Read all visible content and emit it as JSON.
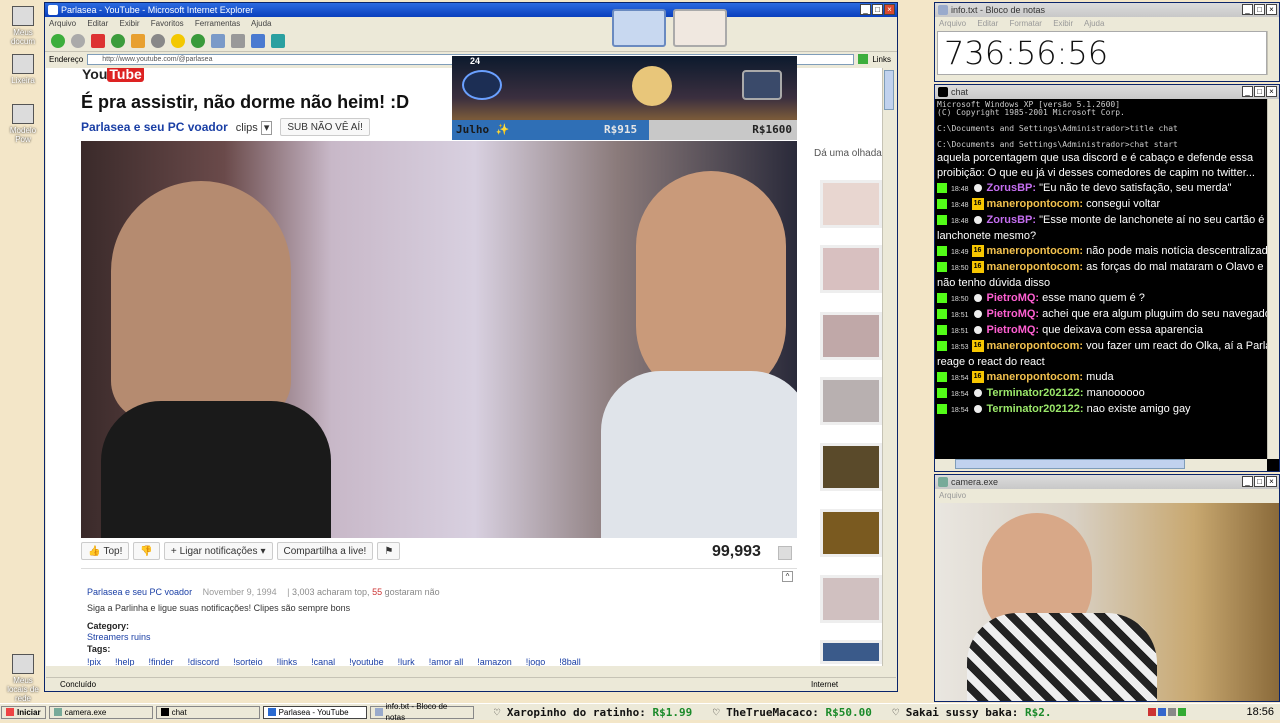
{
  "desktop": {
    "icons": [
      "Meus docum",
      "Lixeira",
      "Modelo Pow",
      "Meus locais de rede"
    ]
  },
  "ie": {
    "title": "Parlasea - YouTube - Microsoft Internet Explorer",
    "menu": [
      "Arquivo",
      "Editar",
      "Exibir",
      "Favoritos",
      "Ferramentas",
      "Ajuda"
    ],
    "address_label": "Endereço",
    "url": "http://www.youtube.com/@parlasea",
    "links_label": "Links",
    "status_left": "Concluído",
    "status_right": "Internet"
  },
  "youtube": {
    "logo": "YouTube",
    "title": "É pra assistir, não dorme não heim! :D",
    "channel": "Parlasea e seu PC voador",
    "clips": "clips",
    "sub_button": "SUB NÃO VÊ AÍ!",
    "like_label": "Top!",
    "notify_label": "Ligar notificações",
    "share_label": "Compartilha a live!",
    "views": "99,993",
    "side_label": "Dá uma olhada",
    "desc_channel": "Parlasea e seu PC voador",
    "desc_date": "November 9, 1994",
    "desc_stats_a": "3,003 acharam top, ",
    "desc_stats_b": "55",
    "desc_stats_c": " gostaram não",
    "desc_text": "Siga a Parlinha e ligue suas notificações! Clipes são sempre bons",
    "category_label": "Category:",
    "category_value": "Streamers ruins",
    "tags_label": "Tags:",
    "tags": [
      "!pix",
      "!help",
      "!finder",
      "!discord",
      "!sorteio",
      "!links",
      "!canal",
      "!youtube",
      "!lurk",
      "!amor all",
      "!amazon",
      "!jogo",
      "!8ball"
    ]
  },
  "game": {
    "month": "Julho ✨",
    "amount_left": "R$915",
    "amount_right": "R$1600",
    "hp": "24"
  },
  "notepad": {
    "title": "info.txt - Bloco de notas",
    "menu": [
      "Arquivo",
      "Editar",
      "Formatar",
      "Exibir",
      "Ajuda"
    ],
    "content": "736:56:56"
  },
  "cmd": {
    "title": "chat",
    "lines": [
      "Microsoft Windows XP [versão 5.1.2600]",
      "(C) Copyright 1985-2001 Microsoft Corp.",
      "C:\\Documents and Settings\\Administrador>title chat",
      "C:\\Documents and Settings\\Administrador>chat start"
    ]
  },
  "chat": {
    "top_text": "aquela porcentagem que usa discord e é cabaço e defende essa proibição: O que eu já vi desses comedores de capim no twitter...",
    "messages": [
      {
        "time": "18:48",
        "badge": "",
        "user": "ZorusBP:",
        "color": "#c46ef0",
        "text": "\"Eu não te devo satisfação, seu merda\""
      },
      {
        "time": "18:48",
        "badge": "16",
        "user": "maneropontocom:",
        "color": "#f2c14e",
        "text": "consegui voltar"
      },
      {
        "time": "18:48",
        "badge": "",
        "user": "ZorusBP:",
        "color": "#c46ef0",
        "text": "\"Esse monte de lanchonete aí no seu cartão é lanchonete mesmo?"
      },
      {
        "time": "18:49",
        "badge": "16",
        "user": "maneropontocom:",
        "color": "#f2c14e",
        "text": "não pode mais notícia descentralizada"
      },
      {
        "time": "18:50",
        "badge": "16",
        "user": "maneropontocom:",
        "color": "#f2c14e",
        "text": "as forças do mal mataram o Olavo e eu não tenho dúvida disso"
      },
      {
        "time": "18:50",
        "badge": "",
        "user": "PietroMQ:",
        "color": "#ff5fd2",
        "text": "esse mano quem é ?"
      },
      {
        "time": "18:51",
        "badge": "",
        "user": "PietroMQ:",
        "color": "#ff5fd2",
        "text": "achei que era algum pluguim do seu navegador"
      },
      {
        "time": "18:51",
        "badge": "",
        "user": "PietroMQ:",
        "color": "#ff5fd2",
        "text": "que deixava com essa aparencia"
      },
      {
        "time": "18:53",
        "badge": "16",
        "user": "maneropontocom:",
        "color": "#f2c14e",
        "text": "vou fazer um react do Olka, aí a Parla reage o react do react"
      },
      {
        "time": "18:54",
        "badge": "16",
        "user": "maneropontocom:",
        "color": "#f2c14e",
        "text": "muda"
      },
      {
        "time": "18:54",
        "badge": "",
        "user": "Terminator202122:",
        "color": "#9be86a",
        "text": "manoooooo"
      },
      {
        "time": "18:54",
        "badge": "",
        "user": "Terminator202122:",
        "color": "#9be86a",
        "text": "nao existe amigo gay"
      }
    ]
  },
  "camera": {
    "title": "camera.exe",
    "menu": "Arquivo"
  },
  "taskbar": {
    "start": "Iniciar",
    "tasks": [
      "camera.exe",
      "chat",
      "Parlasea - YouTube",
      "info.txt - Bloco de notas"
    ],
    "ticker": [
      {
        "name": "Xaropinho do ratinho:",
        "amount": "R$1.99"
      },
      {
        "name": "TheTrueMacaco:",
        "amount": "R$50.00"
      },
      {
        "name": "Sakai sussy baka:",
        "amount": "R$2."
      }
    ],
    "clock": "18:56"
  }
}
